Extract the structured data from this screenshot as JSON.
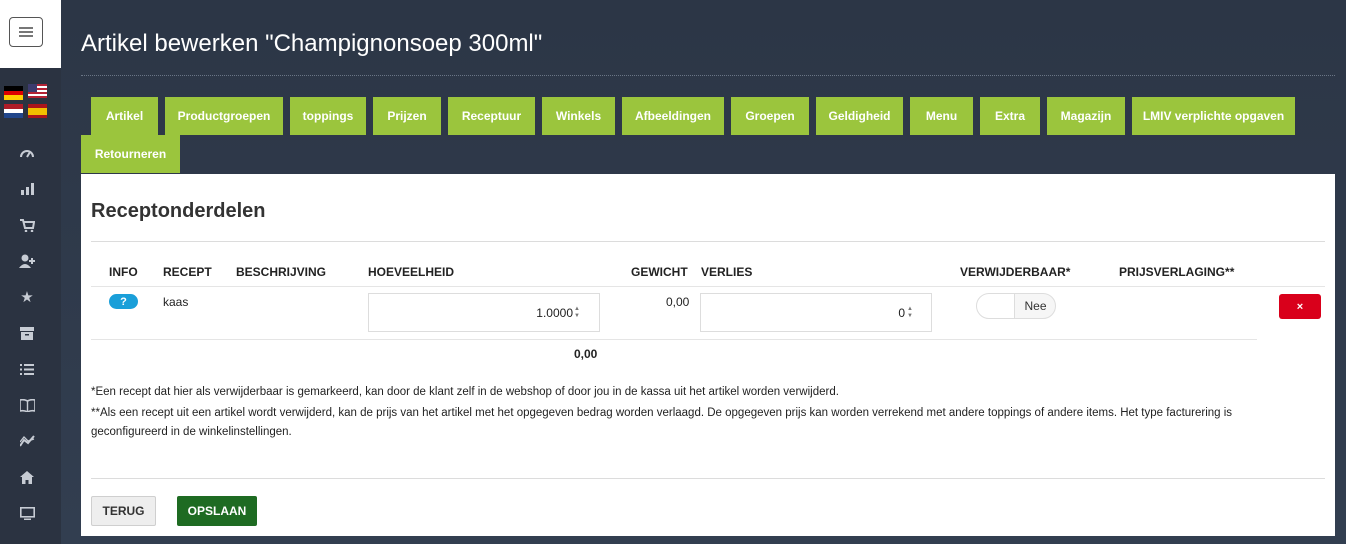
{
  "page": {
    "title": "Artikel bewerken \"Champignonsoep 300ml\""
  },
  "tabs": [
    "Artikel",
    "Productgroepen",
    "toppings",
    "Prijzen",
    "Receptuur",
    "Winkels",
    "Afbeeldingen",
    "Groepen",
    "Geldigheid",
    "Menu",
    "Extra",
    "Magazijn",
    "LMIV verplichte opgaven",
    "Retourneren"
  ],
  "section": {
    "title": "Receptonderdelen"
  },
  "table": {
    "headers": {
      "info": "INFO",
      "recept": "RECEPT",
      "beschrijving": "BESCHRIJVING",
      "hoeveelheid": "HOEVEELHEID",
      "gewicht": "GEWICHT",
      "verlies": "VERLIES",
      "verwijderbaar": "VERWIJDERBAAR*",
      "prijsverlaging": "PRIJSVERLAGING**"
    },
    "rows": [
      {
        "info": "?",
        "recept": "kaas",
        "beschrijving": "",
        "hoeveelheid": "1.0000",
        "gewicht": "0,00",
        "verlies": "0",
        "verwijderbaar": "Nee",
        "delete": "×"
      }
    ],
    "total_gewicht": "0,00"
  },
  "notes": {
    "note1": "*Een recept dat hier als verwijderbaar is gemarkeerd, kan door de klant zelf in de webshop of door jou in de kassa uit het artikel worden verwijderd.",
    "note2": "**Als een recept uit een artikel wordt verwijderd, kan de prijs van het artikel met het opgegeven bedrag worden verlaagd. De opgegeven prijs kan worden verrekend met andere toppings of andere items. Het type facturering is geconfigureerd in de winkelinstellingen."
  },
  "buttons": {
    "back": "TERUG",
    "save": "OPSLAAN"
  },
  "colors": {
    "tab_green": "#9bc53d",
    "save_green": "#1e6b22",
    "delete_red": "#d9001b",
    "info_blue": "#1a9fd9",
    "sidebar": "#2b3341"
  },
  "sidebar_icons": [
    "dashboard-icon",
    "bar-chart-icon",
    "cart-icon",
    "add-user-icon",
    "star-icon",
    "archive-icon",
    "list-icon",
    "book-icon",
    "trend-icon",
    "home-icon",
    "monitor-icon"
  ]
}
